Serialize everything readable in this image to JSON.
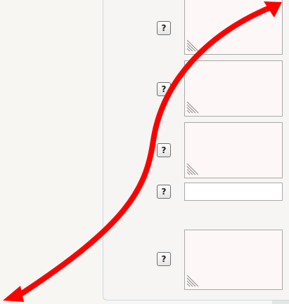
{
  "form": {
    "help_label": "?",
    "fields": [
      {
        "type": "textarea",
        "value": ""
      },
      {
        "type": "textarea",
        "value": ""
      },
      {
        "type": "textarea",
        "value": ""
      },
      {
        "type": "text",
        "value": ""
      },
      {
        "type": "textarea",
        "value": ""
      }
    ]
  },
  "colors": {
    "annotation_arrow": "#ff0000",
    "textarea_background": "#fdf8f7",
    "page_background": "#f7f6f3",
    "panel_border": "#cbd7e1"
  },
  "icons": {
    "help": "help-icon",
    "resize": "resize-grip-icon",
    "annotation": "double-headed-arrow"
  }
}
